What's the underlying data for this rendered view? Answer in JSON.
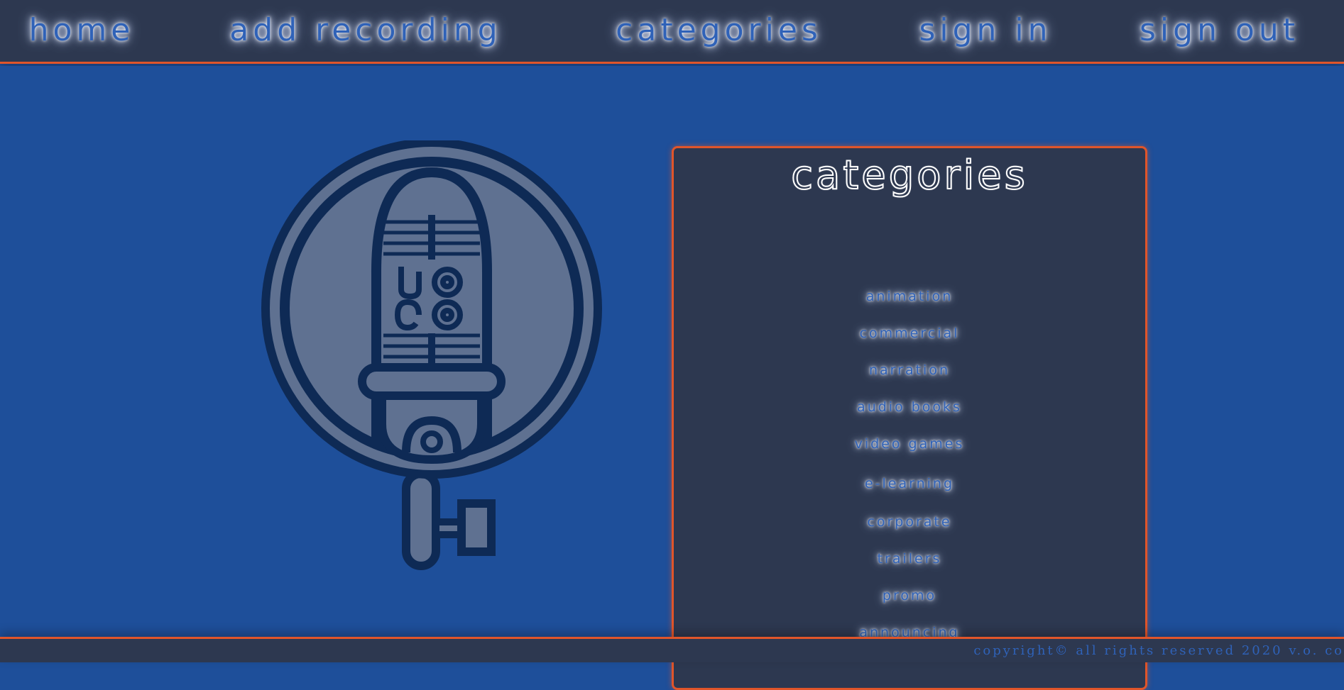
{
  "nav": {
    "home": "Home",
    "add_recording": "Add Recording",
    "categories": "Categories",
    "sign_in": "Sign In",
    "sign_out": "Sign Out"
  },
  "panel": {
    "title": "Categories",
    "items": [
      "Animation",
      "Commercial",
      "Narration",
      "Audio Books",
      "Video Games",
      "E-Learning",
      "Corporate",
      "Trailers",
      "Promo",
      "Announcing"
    ]
  },
  "footer": {
    "text": "Copyright© All Rights Reserved 2020 V.O. Co"
  },
  "colors": {
    "background": "#1e4f9a",
    "bars": "#2d3850",
    "accent": "#e0552a",
    "logo_dark": "#0e2a55",
    "logo_light": "#5f7191"
  },
  "logo": {
    "icon": "microphone-logo-icon",
    "letters": [
      "V",
      "O",
      "C",
      "O"
    ]
  }
}
